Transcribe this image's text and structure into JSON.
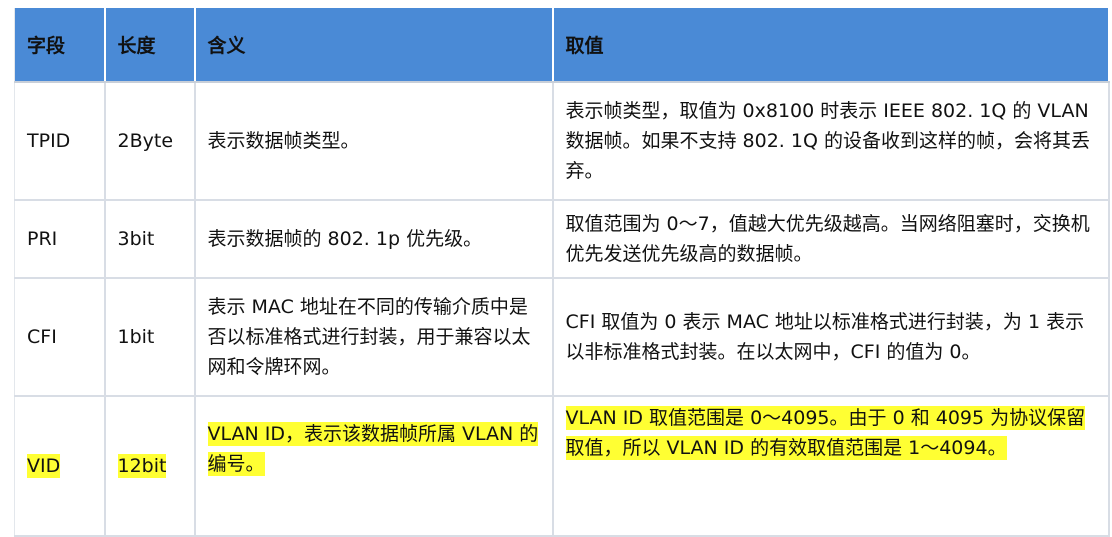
{
  "table": {
    "headers": [
      "字段",
      "长度",
      "含义",
      "取值"
    ],
    "rows": [
      {
        "field": "TPID",
        "length": "2Byte",
        "meaning": "表示数据帧类型。",
        "value": "表示帧类型，取值为 0x8100 时表示 IEEE 802. 1Q 的 VLAN 数据帧。如果不支持 802. 1Q 的设备收到这样的帧，会将其丢弃。"
      },
      {
        "field": "PRI",
        "length": "3bit",
        "meaning": "表示数据帧的 802. 1p 优先级。",
        "value": "取值范围为 0～7，值越大优先级越高。当网络阻塞时，交换机优先发送优先级高的数据帧。"
      },
      {
        "field": "CFI",
        "length": "1bit",
        "meaning": "表示 MAC 地址在不同的传输介质中是否以标准格式进行封装，用于兼容以太网和令牌环网。",
        "value": "CFI 取值为 0 表示 MAC 地址以标准格式进行封装，为 1 表示以非标准格式封装。在以太网中，CFI 的值为 0。"
      },
      {
        "field": "VID",
        "length": "12bit",
        "meaning": "VLAN ID，表示该数据帧所属 VLAN 的编号。",
        "value": "VLAN ID 取值范围是 0～4095。由于 0 和 4095 为协议保留取值，所以 VLAN ID 的有效取值范围是 1～4094。",
        "highlighted": true
      }
    ]
  },
  "colors": {
    "header_bg": "#4a8ad6",
    "highlight": "#ffff33",
    "grid": "#d8dde5"
  }
}
